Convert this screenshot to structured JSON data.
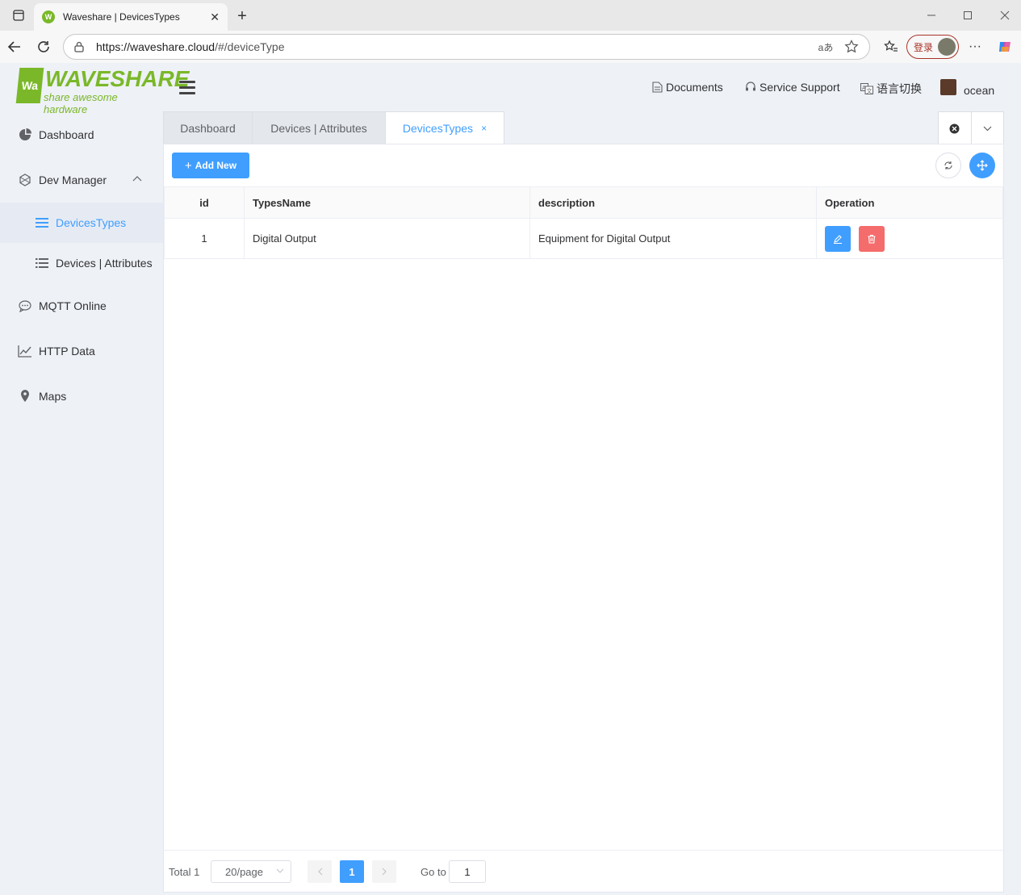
{
  "browser": {
    "tab_title": "Waveshare | DevicesTypes",
    "tab_favicon_text": "W",
    "url_host": "https://waveshare.cloud",
    "url_path": "/#/deviceType",
    "read_aloud_label": "aあ",
    "login_label": "登录"
  },
  "logo": {
    "wordmark": "WAVESHARE",
    "tagline": "share awesome hardware",
    "mark": "Wa"
  },
  "sidebar": {
    "items": [
      {
        "label": "Dashboard",
        "icon": "pie-chart-icon"
      },
      {
        "label": "Dev Manager",
        "icon": "hexagon-icon"
      },
      {
        "label": "DevicesTypes",
        "icon": "list-icon"
      },
      {
        "label": "Devices | Attributes",
        "icon": "list-icon"
      },
      {
        "label": "MQTT Online",
        "icon": "chat-icon"
      },
      {
        "label": "HTTP Data",
        "icon": "line-chart-icon"
      },
      {
        "label": "Maps",
        "icon": "location-icon"
      }
    ]
  },
  "topbar": {
    "documents": "Documents",
    "service_support": "Service Support",
    "language": "语言切换",
    "user": "ocean"
  },
  "view_tabs": [
    {
      "label": "Dashboard"
    },
    {
      "label": "Devices | Attributes"
    },
    {
      "label": "DevicesTypes",
      "close": "×"
    }
  ],
  "toolbar": {
    "add_label": "Add New"
  },
  "table": {
    "columns": [
      "id",
      "TypesName",
      "description",
      "Operation"
    ],
    "rows": [
      {
        "id": "1",
        "name": "Digital Output",
        "description": "Equipment for Digital Output"
      }
    ]
  },
  "pagination": {
    "total": "Total 1",
    "page_size": "20/page",
    "current_page": "1",
    "goto_label": "Go to",
    "goto_value": "1"
  },
  "colors": {
    "primary": "#409eff",
    "danger": "#f56c6c",
    "brand_green": "#7ab829",
    "sidebar_bg": "#eef1f6"
  }
}
